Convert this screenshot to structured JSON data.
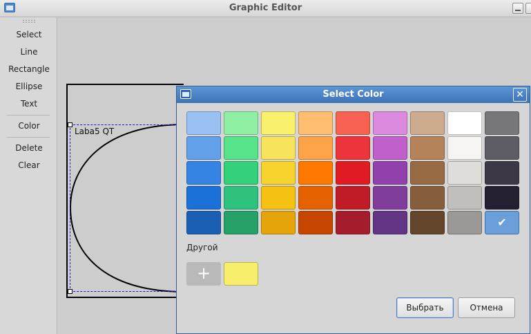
{
  "window": {
    "title": "Graphic Editor"
  },
  "toolbar": {
    "tools": [
      {
        "label": "Select"
      },
      {
        "label": "Line"
      },
      {
        "label": "Rectangle"
      },
      {
        "label": "Ellipse"
      },
      {
        "label": "Text"
      },
      {
        "label": "Color"
      },
      {
        "label": "Delete"
      },
      {
        "label": "Clear"
      }
    ]
  },
  "canvas": {
    "shape_label": "Laba5 QT"
  },
  "dialog": {
    "title": "Select Color",
    "other_label": "Другой",
    "add_symbol": "+",
    "ok_label": "Выбрать",
    "cancel_label": "Отмена",
    "custom_colors": [
      "#f7ee6b"
    ],
    "palette": [
      [
        "#99c1f1",
        "#8ff0a4",
        "#f9f06b",
        "#ffbe6f",
        "#f66151",
        "#dc8add",
        "#cdab8f",
        "#ffffff",
        "#77767b"
      ],
      [
        "#62a0ea",
        "#57e389",
        "#f8e45c",
        "#ffa348",
        "#ed333b",
        "#c061cb",
        "#b5835a",
        "#f6f5f4",
        "#5e5c64"
      ],
      [
        "#3584e4",
        "#33d17a",
        "#f6d32d",
        "#ff7800",
        "#e01b24",
        "#9141ac",
        "#986a44",
        "#deddda",
        "#3d3846"
      ],
      [
        "#1c71d8",
        "#2ec27e",
        "#f5c211",
        "#e66100",
        "#c01c28",
        "#813d9c",
        "#865e3c",
        "#c0bfbc",
        "#241f31"
      ],
      [
        "#1a5fb4",
        "#26a269",
        "#e5a50a",
        "#c64600",
        "#a51d2d",
        "#613583",
        "#63452c",
        "#9a9996",
        "#6b9fd9"
      ]
    ],
    "selected": {
      "row": 4,
      "col": 8
    }
  }
}
